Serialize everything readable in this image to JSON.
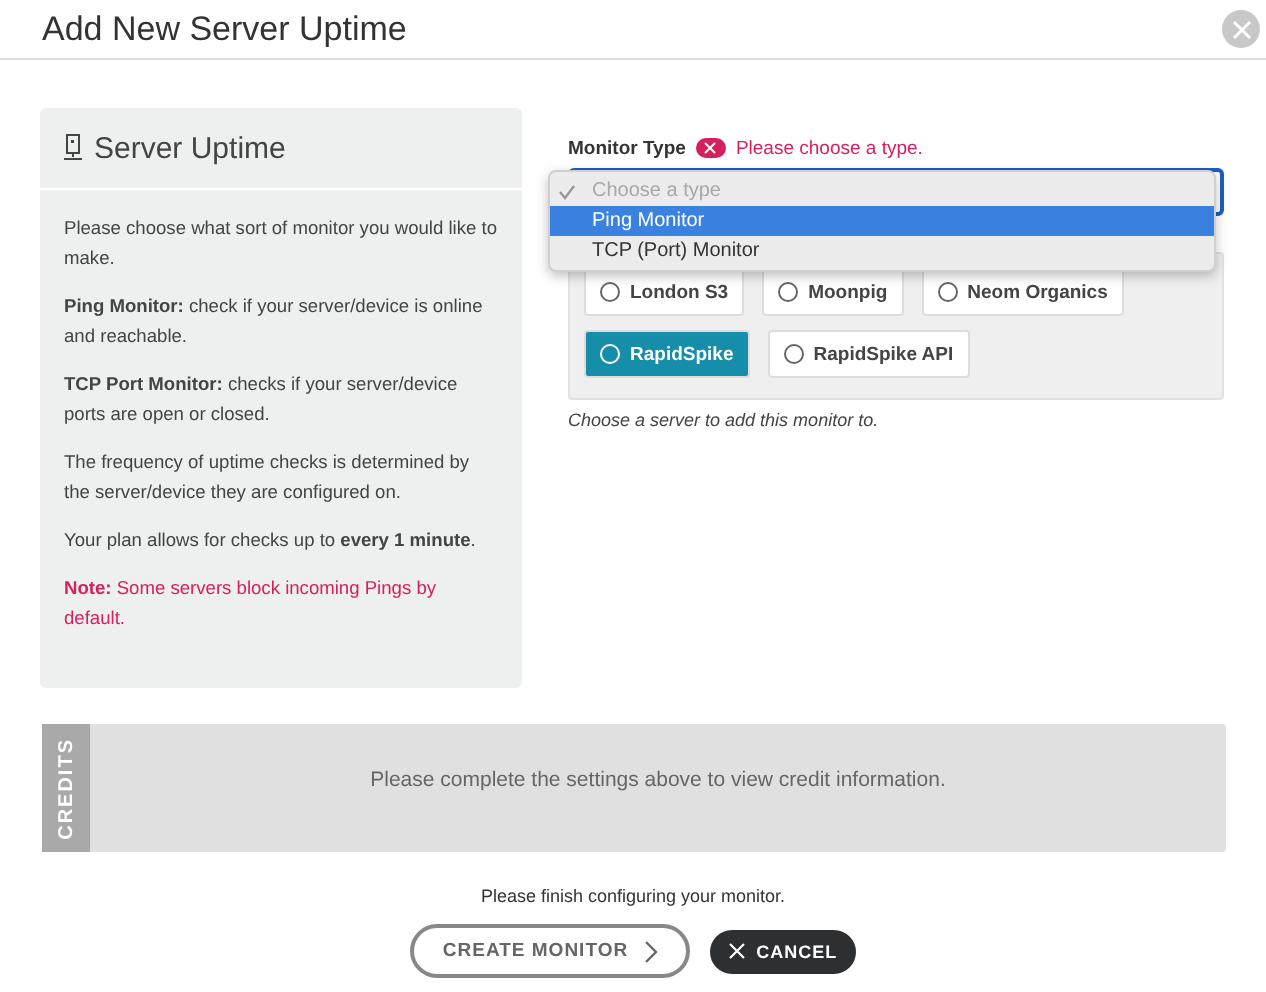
{
  "dialog": {
    "title": "Add New Server Uptime"
  },
  "info_panel": {
    "title": "Server Uptime",
    "paragraphs": [
      {
        "kind": "text",
        "text": "Please choose what sort of monitor you would like to make."
      },
      {
        "kind": "text",
        "text": "**Ping Monitor:** check if your server/device is online and reachable."
      },
      {
        "kind": "text",
        "text": "**TCP Port Monitor:** checks if your server/device ports are open or closed."
      },
      {
        "kind": "text",
        "text": "The frequency of uptime checks is determined by the server/device they are configured on."
      },
      {
        "kind": "text",
        "text": "Your plan allows for checks up to **every 1 minute**."
      },
      {
        "kind": "note",
        "text": "**Note:** Some servers block incoming Pings by default."
      }
    ]
  },
  "monitor_type": {
    "label": "Monitor Type",
    "error": "Please choose a type.",
    "dropdown": {
      "expanded": true,
      "options": [
        {
          "label": "Choose a type",
          "checked": true,
          "disabled": true,
          "selected": false
        },
        {
          "label": "Ping Monitor",
          "checked": false,
          "disabled": false,
          "selected": true
        },
        {
          "label": "TCP (Port) Monitor",
          "checked": false,
          "disabled": false,
          "selected": false
        }
      ]
    }
  },
  "servers": {
    "items": [
      {
        "label": "London S3",
        "selected": false
      },
      {
        "label": "Moonpig",
        "selected": false
      },
      {
        "label": "Neom Organics",
        "selected": false
      },
      {
        "label": "RapidSpike",
        "selected": true
      },
      {
        "label": "RapidSpike API",
        "selected": false
      }
    ],
    "help": "Choose a server to add this monitor to."
  },
  "credits": {
    "tab": "CREDITS",
    "message": "Please complete the settings above to view credit information."
  },
  "footer": {
    "status": "Please finish configuring your monitor.",
    "buttons": [
      {
        "kind": "primary",
        "label": "CREATE MONITOR"
      },
      {
        "kind": "cancel",
        "label": "CANCEL"
      }
    ]
  }
}
